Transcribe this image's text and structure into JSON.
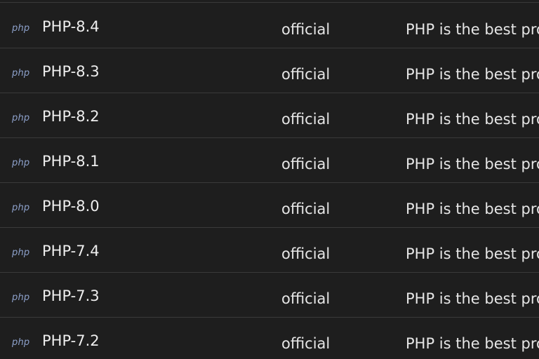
{
  "rows": [
    {
      "icon_text": "php",
      "icon": "php-icon",
      "name": "PHP-8.4",
      "source": "official",
      "description": "PHP is the best pro"
    },
    {
      "icon_text": "php",
      "icon": "php-icon",
      "name": "PHP-8.3",
      "source": "official",
      "description": "PHP is the best pro"
    },
    {
      "icon_text": "php",
      "icon": "php-icon",
      "name": "PHP-8.2",
      "source": "official",
      "description": "PHP is the best pro"
    },
    {
      "icon_text": "php",
      "icon": "php-icon",
      "name": "PHP-8.1",
      "source": "official",
      "description": "PHP is the best pro"
    },
    {
      "icon_text": "php",
      "icon": "php-icon",
      "name": "PHP-8.0",
      "source": "official",
      "description": "PHP is the best pro"
    },
    {
      "icon_text": "php",
      "icon": "php-icon",
      "name": "PHP-7.4",
      "source": "official",
      "description": "PHP is the best pro"
    },
    {
      "icon_text": "php",
      "icon": "php-icon",
      "name": "PHP-7.3",
      "source": "official",
      "description": "PHP is the best pro"
    },
    {
      "icon_text": "php",
      "icon": "php-icon",
      "name": "PHP-7.2",
      "source": "official",
      "description": "PHP is the best pro"
    }
  ],
  "colors": {
    "background": "#1e1e1e",
    "divider": "#3a3a3a",
    "icon": "#8ea2cc",
    "text": "#e6e6e6"
  }
}
